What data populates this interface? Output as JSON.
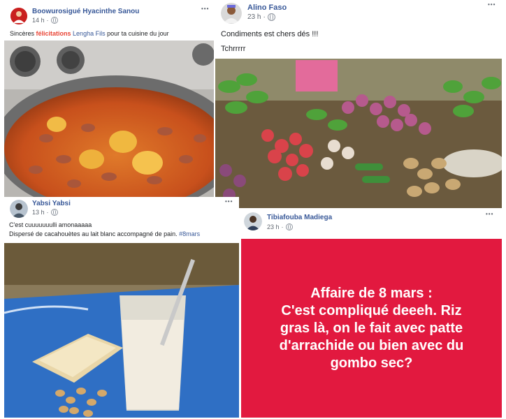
{
  "posts": {
    "p1": {
      "author": "Boowurosigué Hyacinthe Sanou",
      "time": "14 h",
      "more": "•••",
      "text_prefix": "Sincères ",
      "text_highlight": "félicitations",
      "text_middle": " Lengha Fils",
      "text_suffix": " pour ta cuisine du jour",
      "photo_icon": "bean-stew-pot-photo"
    },
    "p2": {
      "author": "Alino Faso",
      "time": "23 h",
      "more": "•••",
      "line1": "Condiments est chers dés !!!",
      "line2": "Tchrrrrr",
      "photo_icon": "market-vegetables-photo"
    },
    "p3": {
      "author": "Yabsi Yabsi",
      "time": "13 h",
      "more": "•••",
      "line1": "C'est cuuuuuuulli amonaaaaa",
      "line2_prefix": "Dispersé de cacahouètes au lait blanc accompagné de pain. ",
      "hashtag": "#8mars",
      "photo_icon": "milk-bread-peanuts-photo"
    },
    "p4": {
      "author": "Tibiafouba Madiega",
      "time": "23 h",
      "more": "•••",
      "card_lines": [
        "Affaire de 8 mars :",
        "C'est compliqué deeeh. Riz",
        "gras là, on le fait avec patte",
        "d'arrachide ou bien avec du",
        "gombo sec?"
      ],
      "card_color": "#e2193f"
    }
  },
  "colors": {
    "link": "#385898",
    "meta": "#606770",
    "highlight": "#e94435"
  }
}
